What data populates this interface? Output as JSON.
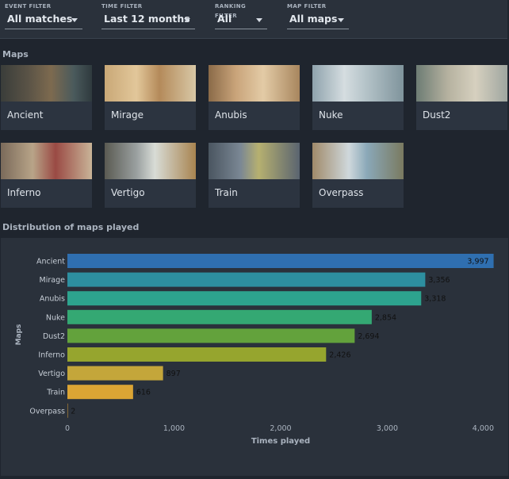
{
  "filters": [
    {
      "label": "EVENT FILTER",
      "value": "All matches"
    },
    {
      "label": "TIME FILTER",
      "value": "Last 12 months"
    },
    {
      "label": "RANKING FILTER",
      "value": "All"
    },
    {
      "label": "MAP FILTER",
      "value": "All maps"
    }
  ],
  "maps_section": {
    "title": "Maps"
  },
  "maps": [
    {
      "name": "Ancient"
    },
    {
      "name": "Mirage"
    },
    {
      "name": "Anubis"
    },
    {
      "name": "Nuke"
    },
    {
      "name": "Dust2"
    },
    {
      "name": "Inferno"
    },
    {
      "name": "Vertigo"
    },
    {
      "name": "Train"
    },
    {
      "name": "Overpass"
    }
  ],
  "distribution_section": {
    "title": "Distribution of maps played"
  },
  "chart_data": {
    "type": "bar",
    "orientation": "horizontal",
    "categories": [
      "Ancient",
      "Mirage",
      "Anubis",
      "Nuke",
      "Dust2",
      "Inferno",
      "Vertigo",
      "Train",
      "Overpass"
    ],
    "values": [
      3997,
      3356,
      3318,
      2854,
      2694,
      2426,
      897,
      616,
      2
    ],
    "value_labels": [
      "3,997",
      "3,356",
      "3,318",
      "2,854",
      "2,694",
      "2,426",
      "897",
      "616",
      "2"
    ],
    "colors": [
      "#2f6fb0",
      "#2d8fa0",
      "#2da38e",
      "#34a873",
      "#63a23c",
      "#96a52e",
      "#c4a63a",
      "#dca534",
      "#e0a030"
    ],
    "xlabel": "Times played",
    "ylabel": "Maps",
    "xlim": [
      0,
      4000
    ],
    "xticks": [
      0,
      1000,
      2000,
      3000,
      4000
    ],
    "xtick_labels": [
      "0",
      "1,000",
      "2,000",
      "3,000",
      "4,000"
    ],
    "grid": false
  }
}
